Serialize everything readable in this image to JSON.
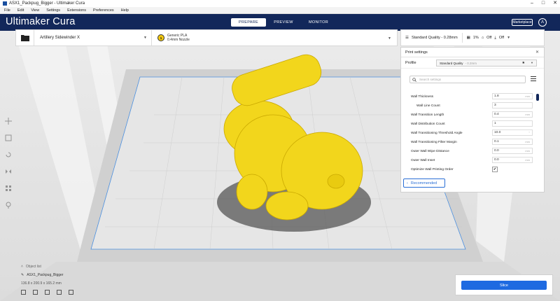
{
  "window": {
    "title": "ASX1_Packpug_Bigger - Ultimaker Cura"
  },
  "menu": [
    "File",
    "Edit",
    "View",
    "Settings",
    "Extensions",
    "Preferences",
    "Help"
  ],
  "header": {
    "logo_brand": "Ultimaker",
    "logo_product": "Cura",
    "stages": [
      "PREPARE",
      "PREVIEW",
      "MONITOR"
    ],
    "active_stage": "PREPARE",
    "marketplace": "Marketplace",
    "account_initial": "A"
  },
  "toolbar": {
    "printer": "Artillery Sidewinder X",
    "material_line1": "Generic PLA",
    "material_line2": "0.4mm Nozzle",
    "extruder_number": "1"
  },
  "quality": {
    "profile": "Standard Quality - 0.28mm",
    "infill": "1%",
    "support": "Off",
    "adhesion": "Off"
  },
  "print_settings": {
    "title": "Print settings",
    "profile_label": "Profile",
    "profile_value": "Standard Quality",
    "profile_detail": "- 0.2mm",
    "search_placeholder": "Search settings",
    "rows": [
      {
        "label": "Wall Thickness",
        "value": "1.8",
        "unit": "mm"
      },
      {
        "label": "Wall Line Count",
        "value": "3",
        "unit": ""
      },
      {
        "label": "Wall Transition Length",
        "value": "0.4",
        "unit": "mm"
      },
      {
        "label": "Wall Distribution Count",
        "value": "1",
        "unit": ""
      },
      {
        "label": "Wall Transitioning Threshold Angle",
        "value": "10.0",
        "unit": "°"
      },
      {
        "label": "Wall Transitioning Filter Margin",
        "value": "0.1",
        "unit": "mm"
      },
      {
        "label": "Outer Wall Wipe Distance",
        "value": "0.0",
        "unit": "mm"
      },
      {
        "label": "Outer Wall Inset",
        "value": "0.0",
        "unit": "mm"
      }
    ],
    "optimize_label": "Optimize Wall Printing Order",
    "optimize_checked": "✔",
    "recommended": "Recommended"
  },
  "object_list": {
    "label": "Object list",
    "object_name": "ASX1_Packpug_Bigger",
    "dimensions": "136.8 x 200.9 x 165.2 mm"
  },
  "slice": {
    "label": "Slice"
  },
  "colors": {
    "header": "#12275a",
    "accent": "#1e6ae1",
    "model": "#f2d61c"
  }
}
